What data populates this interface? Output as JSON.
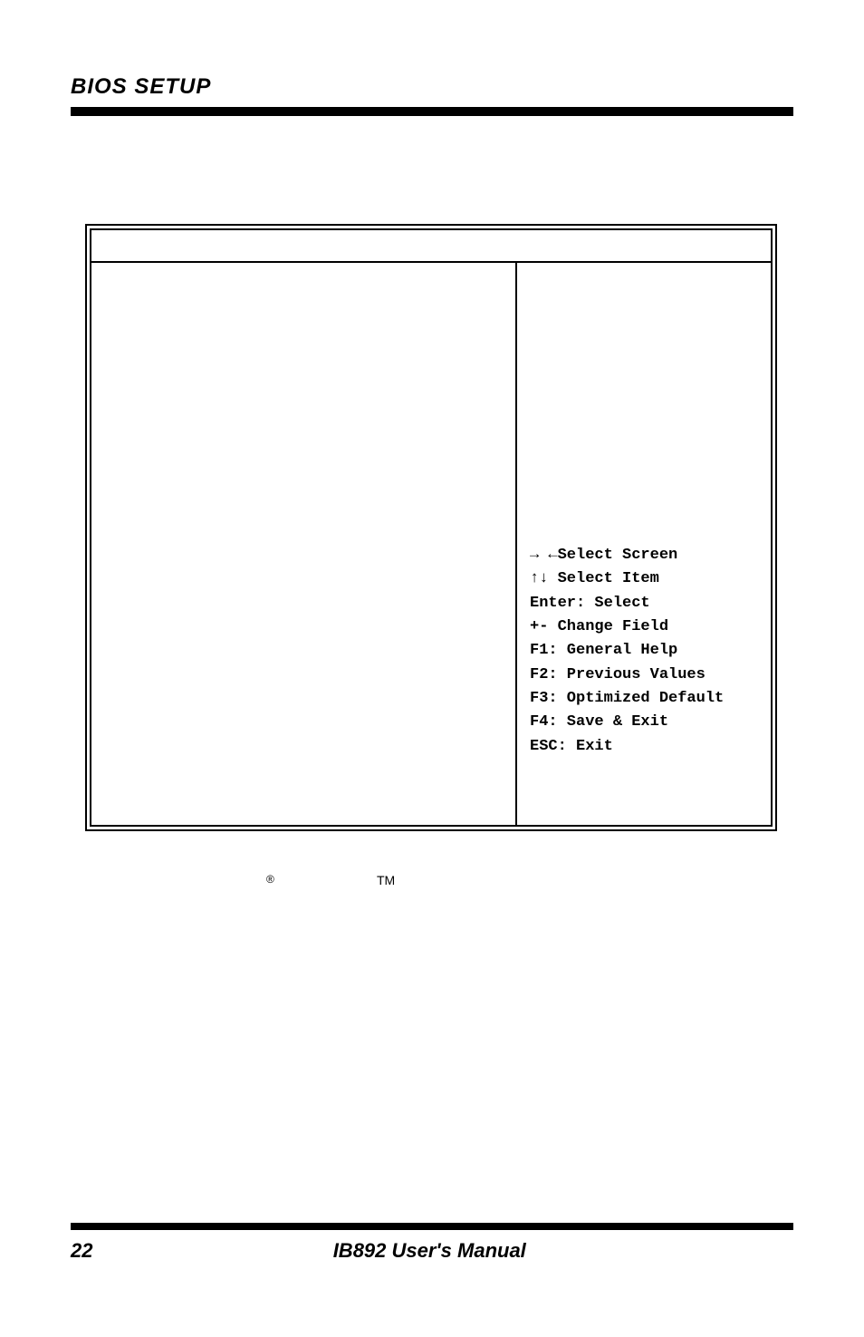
{
  "header": {
    "title": "BIOS SETUP"
  },
  "bios_help": {
    "l1": "→ ←Select Screen",
    "l2": "↑↓ Select Item",
    "l3": "Enter: Select",
    "l4": "+-  Change Field",
    "l5": "F1: General Help",
    "l6": "F2: Previous Values",
    "l7": "F3: Optimized Default",
    "l8": "F4: Save & Exit",
    "l9": "ESC: Exit"
  },
  "superscripts": {
    "reg": "®",
    "tm": "TM"
  },
  "footer": {
    "page": "22",
    "center": "IB892 User's Manual"
  }
}
